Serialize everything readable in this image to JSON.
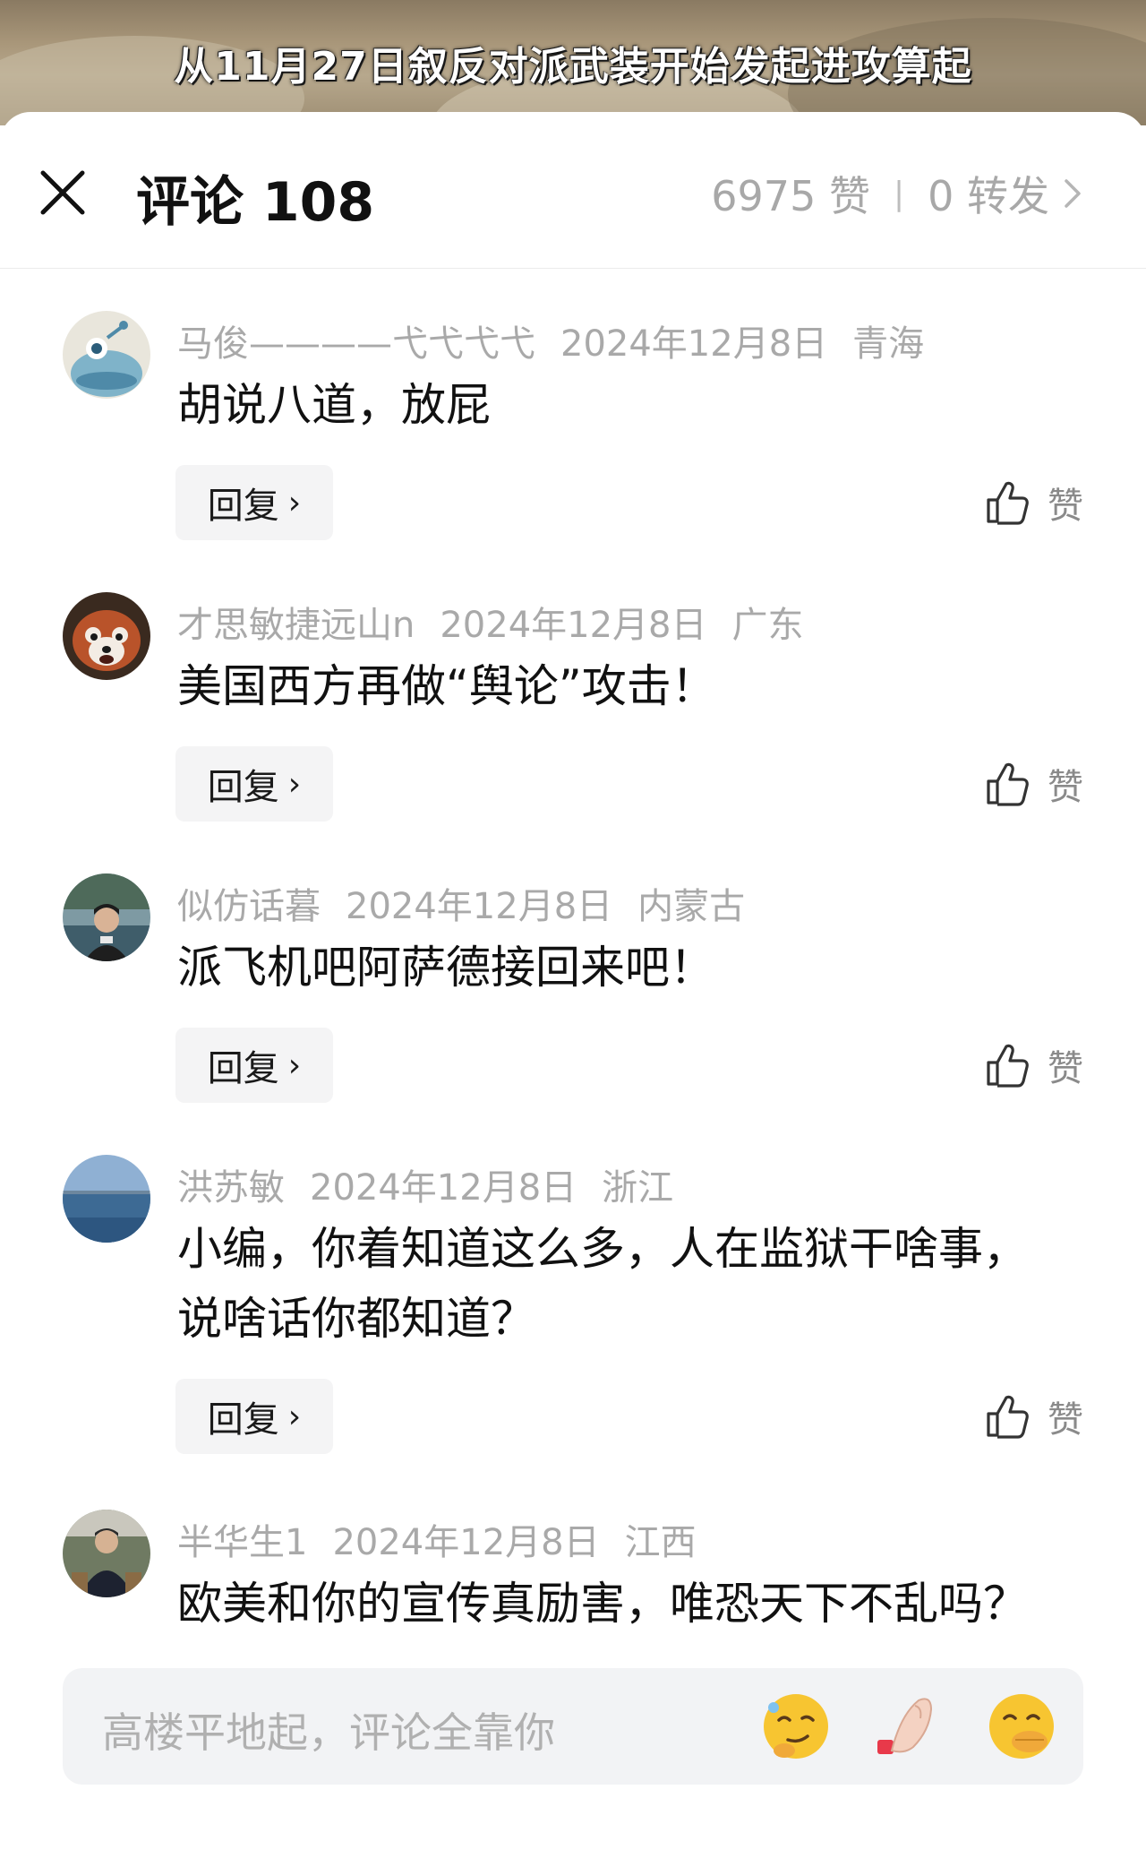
{
  "video": {
    "subtitle": "从11月27日叙反对派武装开始发起进攻算起"
  },
  "header": {
    "title": "评论 108",
    "likes": "6975 赞",
    "separator": "|",
    "shares": "0 转发"
  },
  "comments": [
    {
      "user": "马俊————弋弋弋弋",
      "date": "2024年12月8日",
      "location": "青海",
      "text": "胡说八道，放屁",
      "reply_label": "回复",
      "like_label": "赞",
      "avatar_icon": "blue-cartoon-avatar-icon"
    },
    {
      "user": "才思敏捷远山n",
      "date": "2024年12月8日",
      "location": "广东",
      "text": "美国西方再做“舆论”攻击！",
      "reply_label": "回复",
      "like_label": "赞",
      "avatar_icon": "red-panda-avatar-icon"
    },
    {
      "user": "似仿话暮",
      "date": "2024年12月8日",
      "location": "内蒙古",
      "text": "派飞机吧阿萨德接回来吧！",
      "reply_label": "回复",
      "like_label": "赞",
      "avatar_icon": "person-photo-avatar-icon"
    },
    {
      "user": "洪苏敏",
      "date": "2024年12月8日",
      "location": "浙江",
      "text_line1": "小编，你着知道这么多，人在监狱干啥事，",
      "text_line2": "说啥话你都知道？",
      "reply_label": "回复",
      "like_label": "赞",
      "avatar_icon": "sea-landscape-avatar-icon"
    },
    {
      "user": "半华生1",
      "date": "2024年12月8日",
      "location": "江西",
      "text": "欧美和你的宣传真励害，唯恐天下不乱吗？",
      "avatar_icon": "seated-man-avatar-icon"
    }
  ],
  "input": {
    "placeholder": "高楼平地起，评论全靠你"
  },
  "emoji": [
    "thinking-smirk-emoji-icon",
    "pinched-fingers-emoji-icon",
    "hand-over-mouth-emoji-icon"
  ],
  "colors": {
    "meta_gray": "#a9a9a9",
    "input_bg": "#f2f3f5",
    "reply_bg": "#f4f4f5"
  }
}
